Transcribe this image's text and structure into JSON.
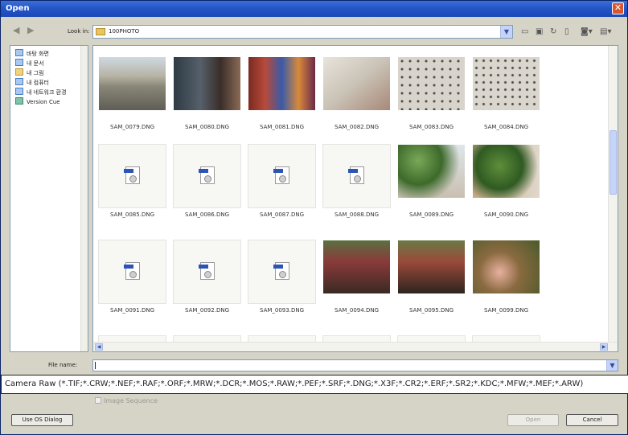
{
  "window": {
    "title": "Open",
    "close": "✕"
  },
  "toolbar": {
    "look_in_label": "Look in:",
    "look_in_value": "100PHOTO",
    "icons": [
      "back-icon",
      "forward-icon",
      "up-folder-icon",
      "new-folder-icon",
      "refresh-icon",
      "recycle-bin-icon",
      "camera-icon",
      "view-menu-icon"
    ]
  },
  "places": [
    {
      "label": "바탕 화면",
      "icon": "desktop-icon"
    },
    {
      "label": "내 문서",
      "icon": "my-documents-icon"
    },
    {
      "label": "내 그림",
      "icon": "my-pictures-icon"
    },
    {
      "label": "내 컴퓨터",
      "icon": "my-computer-icon"
    },
    {
      "label": "내 네트워크 환경",
      "icon": "network-icon"
    },
    {
      "label": "Version Cue",
      "icon": "version-cue-icon"
    }
  ],
  "files": [
    {
      "name": "SAM_0079.DNG",
      "kind": "photo",
      "tone": "p-street"
    },
    {
      "name": "SAM_0080.DNG",
      "kind": "photo",
      "tone": "p-door"
    },
    {
      "name": "SAM_0081.DNG",
      "kind": "photo",
      "tone": "p-cloth"
    },
    {
      "name": "SAM_0082.DNG",
      "kind": "photo",
      "tone": "p-wall"
    },
    {
      "name": "SAM_0083.DNG",
      "kind": "photo",
      "tone": "p-dots"
    },
    {
      "name": "SAM_0084.DNG",
      "kind": "photo",
      "tone": "p-dots2"
    },
    {
      "name": "SAM_0085.DNG",
      "kind": "icon"
    },
    {
      "name": "SAM_0086.DNG",
      "kind": "icon"
    },
    {
      "name": "SAM_0087.DNG",
      "kind": "icon"
    },
    {
      "name": "SAM_0088.DNG",
      "kind": "icon"
    },
    {
      "name": "SAM_0089.DNG",
      "kind": "photo",
      "tone": "p-tree1"
    },
    {
      "name": "SAM_0090.DNG",
      "kind": "photo",
      "tone": "p-tree2"
    },
    {
      "name": "SAM_0091.DNG",
      "kind": "icon"
    },
    {
      "name": "SAM_0092.DNG",
      "kind": "icon"
    },
    {
      "name": "SAM_0093.DNG",
      "kind": "icon"
    },
    {
      "name": "SAM_0094.DNG",
      "kind": "photo",
      "tone": "p-fl1"
    },
    {
      "name": "SAM_0095.DNG",
      "kind": "photo",
      "tone": "p-fl2"
    },
    {
      "name": "SAM_0099.DNG",
      "kind": "photo",
      "tone": "p-fl3"
    }
  ],
  "file_name": {
    "label": "File name:",
    "value": ""
  },
  "files_of_type": "Camera Raw (*.TIF;*.CRW;*.NEF;*.RAF;*.ORF;*.MRW;*.DCR;*.MOS;*.RAW;*.PEF;*.SRF;*.DNG;*.X3F;*.CR2;*.ERF;*.SR2;*.KDC;*.MFW;*.MEF;*.ARW)",
  "image_sequence_label": "Image Sequence",
  "buttons": {
    "os_dialog": "Use OS Dialog",
    "open": "Open",
    "cancel": "Cancel"
  },
  "colors": {
    "titlebar": "#2456c8",
    "dialog_bg": "#d6d3c7",
    "field_border": "#7f9db9"
  }
}
